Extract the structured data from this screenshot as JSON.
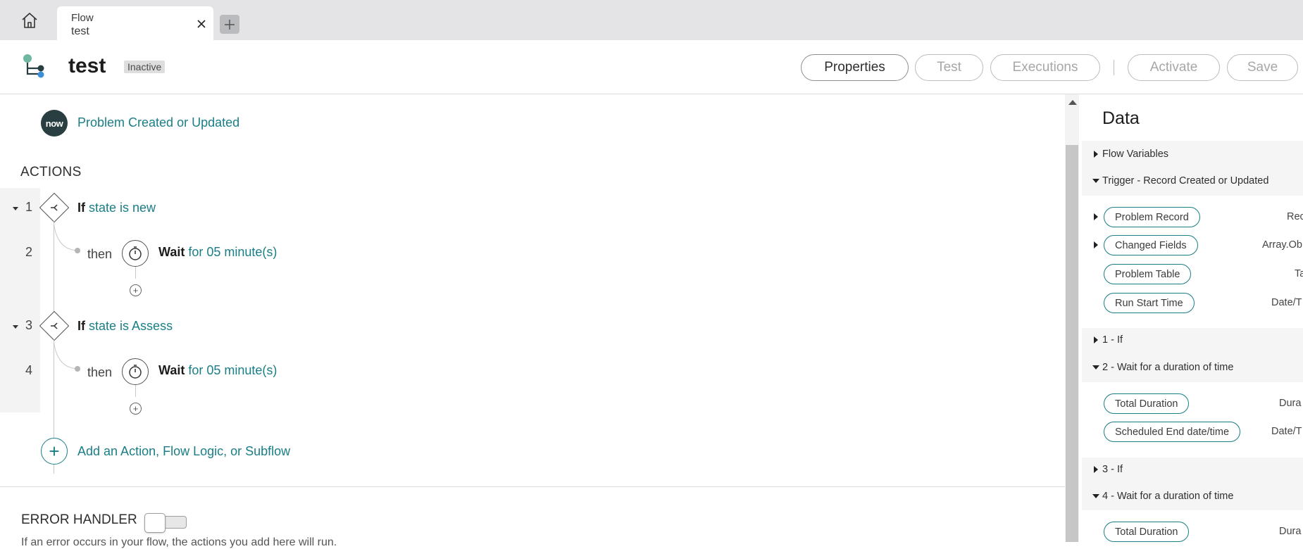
{
  "tabbar": {
    "tab": {
      "type": "Flow",
      "name": "test"
    }
  },
  "header": {
    "title": "test",
    "status": "Inactive",
    "buttons": {
      "properties": "Properties",
      "test": "Test",
      "executions": "Executions",
      "activate": "Activate",
      "save": "Save"
    }
  },
  "main": {
    "trigger": {
      "icon_text": "now",
      "label": "Problem Created or Updated"
    },
    "actions_heading": "ACTIONS",
    "steps": [
      {
        "num": "1",
        "keyword": "If",
        "detail": "state is new"
      },
      {
        "num": "2",
        "then": "then",
        "keyword": "Wait",
        "detail": "for 05 minute(s)"
      },
      {
        "num": "3",
        "keyword": "If",
        "detail": "state is Assess"
      },
      {
        "num": "4",
        "then": "then",
        "keyword": "Wait",
        "detail": "for 05 minute(s)"
      }
    ],
    "add_action_label": "Add an Action, Flow Logic, or Subflow",
    "error_handler": {
      "heading": "ERROR HANDLER",
      "description": "If an error occurs in your flow, the actions you add here will run."
    }
  },
  "data_panel": {
    "title": "Data",
    "sections": {
      "flow_variables": "Flow Variables",
      "trigger": "Trigger - Record Created or Updated",
      "step1": "1 - If",
      "step2": "2 - Wait for a duration of time",
      "step3": "3 - If",
      "step4": "4 - Wait for a duration of time"
    },
    "trigger_pills": [
      {
        "label": "Problem Record",
        "type": "Rec"
      },
      {
        "label": "Changed Fields",
        "type": "Array.Ob"
      },
      {
        "label": "Problem Table",
        "type": "Ta"
      },
      {
        "label": "Run Start Time",
        "type": "Date/T"
      }
    ],
    "step2_pills": [
      {
        "label": "Total Duration",
        "type": "Dura"
      },
      {
        "label": "Scheduled End date/time",
        "type": "Date/T"
      }
    ],
    "step4_pills": [
      {
        "label": "Total Duration",
        "type": "Dura"
      }
    ]
  },
  "colors": {
    "accent": "#1a7e86",
    "trigger_icon_bg": "#293e40"
  }
}
